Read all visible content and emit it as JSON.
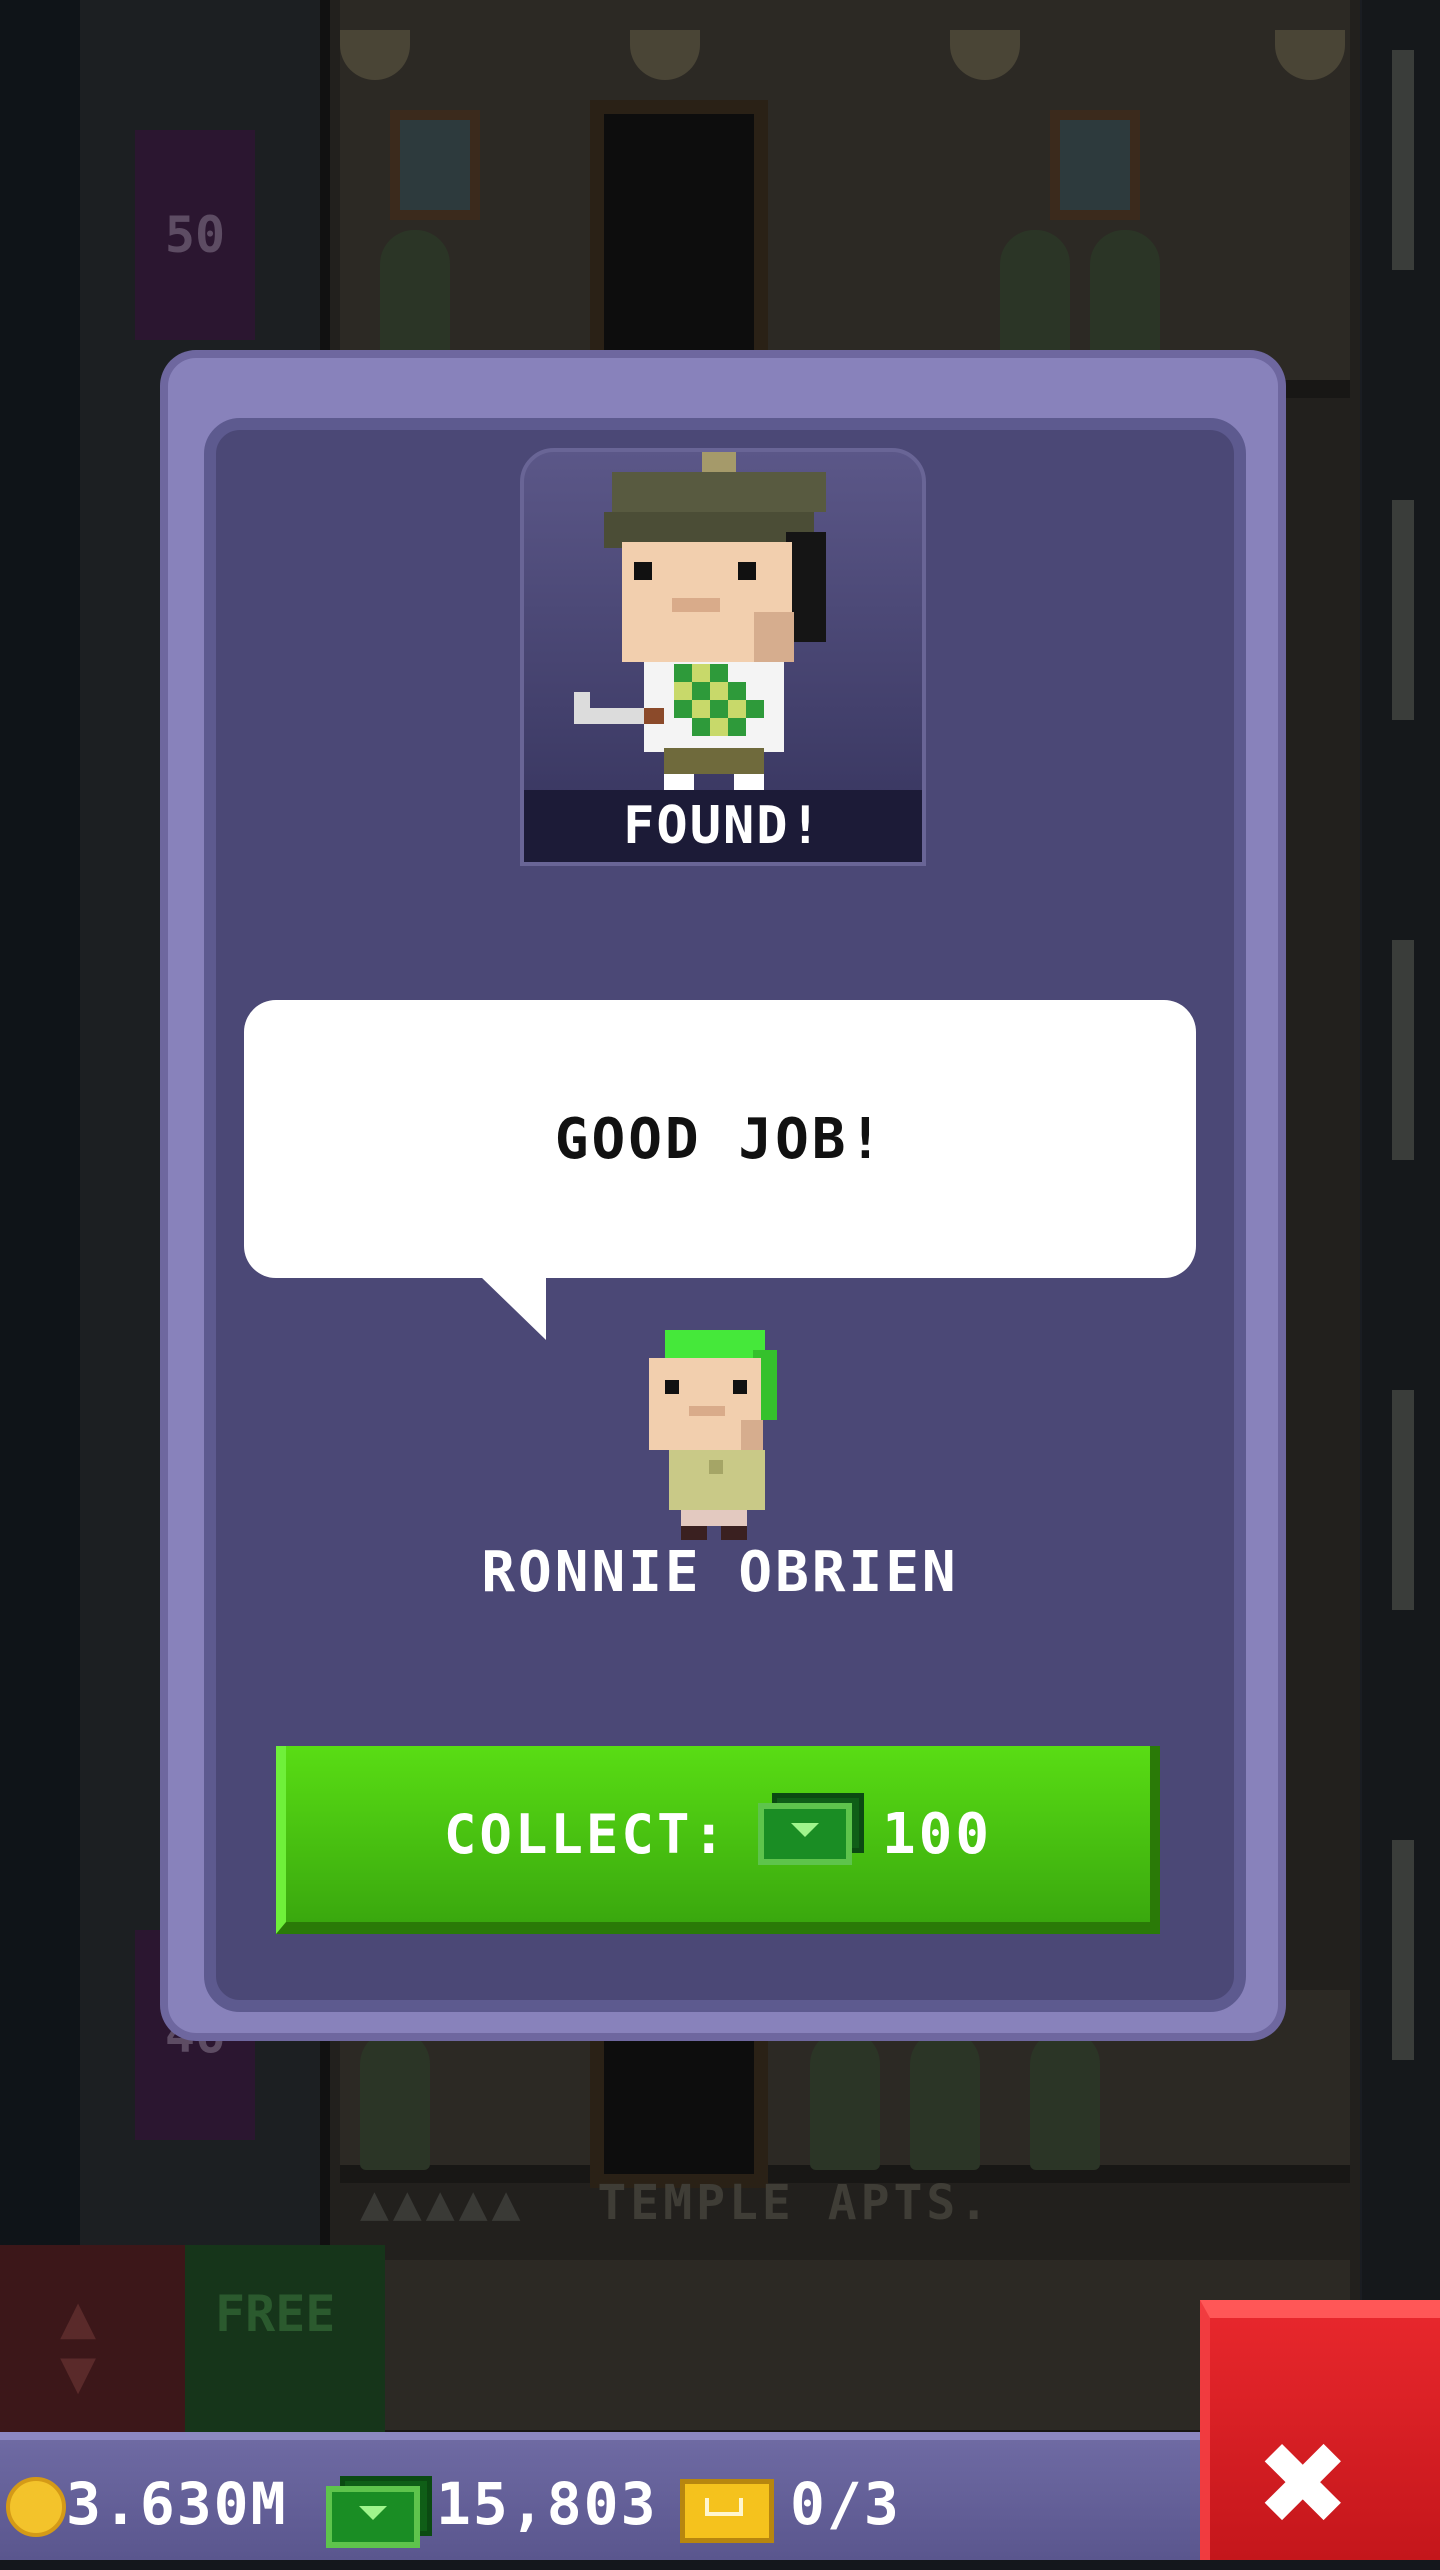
{
  "background": {
    "floor_upper": "50",
    "floor_lower": "46",
    "apartment_name": "TEMPLE APTS.",
    "apartment_stars": "▲▲▲▲▲",
    "free_label": "FREE"
  },
  "modal": {
    "status_label": "FOUND!",
    "speech": "GOOD JOB!",
    "npc_name": "RONNIE OBRIEN",
    "collect_label": "COLLECT:",
    "collect_amount": "100"
  },
  "statusbar": {
    "coins": "3.630M",
    "bux": "15,803",
    "tickets": "0/3"
  },
  "icons": {
    "coin": "coin-icon",
    "bux": "bux-icon",
    "ticket": "golden-ticket-icon",
    "close": "close-icon",
    "elevator": "elevator-arrows-icon"
  },
  "colors": {
    "modal_frame": "#8882bb",
    "modal_panel": "#4b4876",
    "collect_button": "#4bc811",
    "close_button": "#d81e23",
    "status_bar": "#6560a0"
  }
}
